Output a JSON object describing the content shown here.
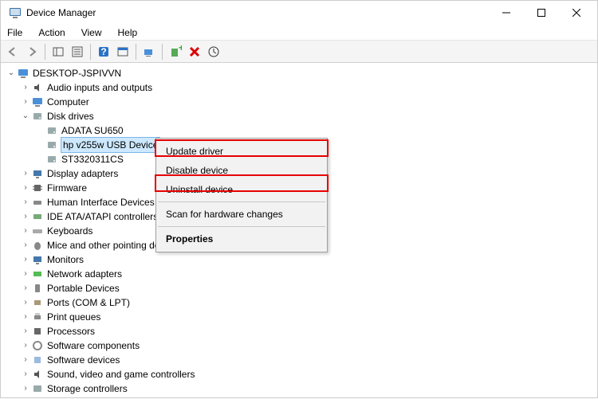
{
  "window": {
    "title": "Device Manager"
  },
  "menu": {
    "file": "File",
    "action": "Action",
    "view": "View",
    "help": "Help"
  },
  "tree": {
    "root": "DESKTOP-JSPIVVN",
    "disk_drives": {
      "label": "Disk drives",
      "items": [
        "ADATA SU650",
        "hp v255w USB Device",
        "ST3320311CS"
      ]
    },
    "categories": {
      "audio": "Audio inputs and outputs",
      "computer": "Computer",
      "display": "Display adapters",
      "firmware": "Firmware",
      "hid": "Human Interface Devices",
      "ide": "IDE ATA/ATAPI controllers",
      "keyboards": "Keyboards",
      "mice": "Mice and other pointing devices",
      "monitors": "Monitors",
      "network": "Network adapters",
      "portable": "Portable Devices",
      "ports": "Ports (COM & LPT)",
      "printq": "Print queues",
      "processors": "Processors",
      "softcomp": "Software components",
      "softdev": "Software devices",
      "sound": "Sound, video and game controllers",
      "storage": "Storage controllers"
    }
  },
  "context_menu": {
    "update": "Update driver",
    "disable": "Disable device",
    "uninstall": "Uninstall device",
    "scan": "Scan for hardware changes",
    "properties": "Properties"
  }
}
